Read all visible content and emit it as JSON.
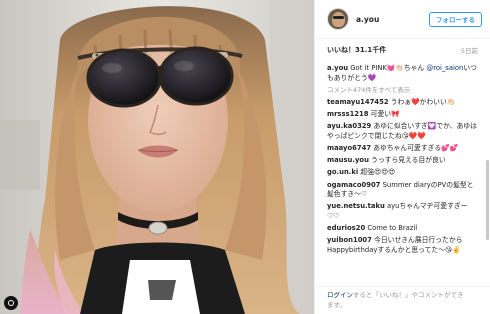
{
  "post": {
    "username": "a.you",
    "follow_label": "フォローする",
    "likes": "いいね！31.1千件",
    "date": "5日前",
    "caption": {
      "user": "a.you",
      "text": "Got it PINK",
      "emoji": "💓👏🏻",
      "rest": "ちゃん",
      "mention": "@roi_saion",
      "tail": "いつもありがとう💜"
    },
    "more_comments": "コメント474件をすべて表示",
    "comments": [
      {
        "user": "teamayu147452",
        "text": "うわぁ❤️かわいい👏🏻"
      },
      {
        "user": "mrsss1218",
        "text": "可愛い🎀"
      },
      {
        "user": "ayu.ka0329",
        "text": "あゆに似合いすぎ💟でか、あゆはやっぱピンクで閉じたね😘❤️❤️"
      },
      {
        "user": "maayo6747",
        "text": "あゆちゃん可愛すぎる💕💕"
      },
      {
        "user": "mausu.you",
        "text": "うっすら見える目が良い"
      },
      {
        "user": "go.un.ki",
        "text": "超強😍😍😍"
      },
      {
        "user": "ogamaco0907",
        "text": "Summer diaryのPVの髪型と髪色すき〜♡"
      },
      {
        "user": "yue.netsu.taku",
        "text": "ayuちゃんマヂ可愛すぎー♡♡"
      },
      {
        "user": "edurios20",
        "text": "Come to Brazil"
      },
      {
        "user": "yuibon1007",
        "text": "今日いせきん展日行ったからHappybirthdayするんかと思ってた〜😘✌️"
      }
    ],
    "footer": {
      "login": "ログイン",
      "middle": "すると「いいね！」やコメントができ",
      "end": "ます。"
    }
  },
  "icons": {
    "logo": "instagram-glyph-icon",
    "avatar": "profile-avatar"
  },
  "colors": {
    "accent": "#3897f0",
    "mention": "#003569",
    "muted": "#999999",
    "hair": "#c89b6a",
    "pink_hair": "#e8a7c0"
  }
}
